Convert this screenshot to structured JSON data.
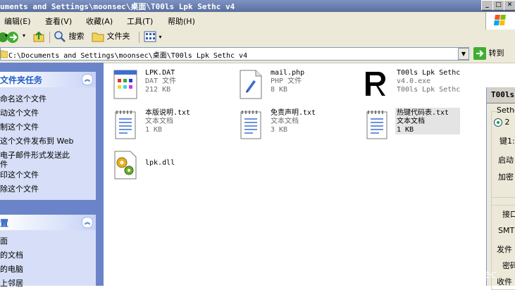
{
  "window": {
    "title": "uments and Settings\\moonsec\\桌面\\T00ls Lpk Sethc v4",
    "controls": {
      "minimize": "_",
      "maximize": "□",
      "close": "✕"
    }
  },
  "menu": [
    "编辑(E)",
    "查看(V)",
    "收藏(A)",
    "工具(T)",
    "帮助(H)"
  ],
  "toolbar": {
    "back_arrow": "▾",
    "search_label": "搜索",
    "folders_label": "文件夹",
    "views_arrow": "▾"
  },
  "address": {
    "value": "C:\\Documents and Settings\\moonsec\\桌面\\T00ls Lpk Sethc v4",
    "go_label": "转到"
  },
  "left_panel": {
    "tasks_title": "文件夹任务",
    "tasks": [
      "命名这个文件",
      "动这个文件",
      "制这个文件",
      "这个文件发布到 Web",
      "电子邮件形式发送此",
      "件",
      "印这个文件",
      "除这个文件"
    ],
    "places_title": "置",
    "places": [
      "面",
      "的文档",
      "的电脑",
      "上邻居"
    ]
  },
  "files": [
    {
      "name": "LPK.DAT",
      "type": "DAT 文件",
      "size": "212 KB",
      "icon": "dat-file-icon"
    },
    {
      "name": "mail.php",
      "type": "PHP 文件",
      "size": "8 KB",
      "icon": "php-file-icon"
    },
    {
      "name": "T00ls Lpk Sethc",
      "name2": "v4.0.exe",
      "type": "T00ls Lpk Sethc",
      "icon": "t00ls-app-icon"
    },
    {
      "name": "本版说明.txt",
      "type": "文本文档",
      "size": "1 KB",
      "icon": "text-file-icon"
    },
    {
      "name": "免责声明.txt",
      "type": "文本文档",
      "size": "3 KB",
      "icon": "text-file-icon"
    },
    {
      "name": "热键代码表.txt",
      "type": "文本文档",
      "size": "1 KB",
      "icon": "text-file-icon"
    },
    {
      "name": "lpk.dll",
      "icon": "dll-file-icon"
    }
  ],
  "float_window": {
    "title": "T00ls",
    "group1": "Sethc",
    "radio_label": "2",
    "row1": "键1:",
    "row2": "启动",
    "row3": "加密",
    "row4": "接口",
    "row5": "SMT",
    "row6": "发件",
    "row7": "密码",
    "row8": "收件"
  },
  "watermark": "nsec"
}
